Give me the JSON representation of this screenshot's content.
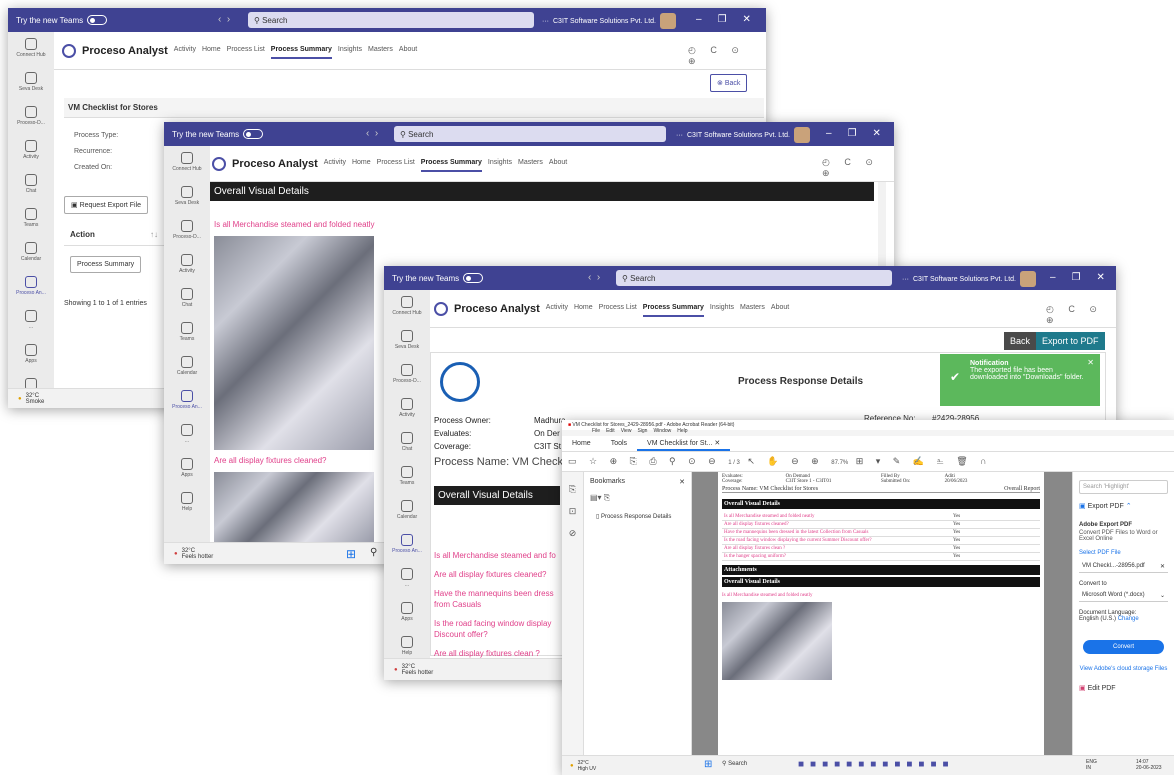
{
  "teams_common": {
    "try_label": "Try the new Teams",
    "search_placeholder": "Search",
    "org_name": "C3IT Software Solutions Pvt. Ltd.",
    "app_name": "Proceso Analyst",
    "nav": [
      "Activity",
      "Home",
      "Process List",
      "Process Summary",
      "Insights",
      "Masters",
      "About"
    ],
    "rail": [
      "Connect Hub",
      "Seva Desk",
      "Proceso-D...",
      "Activity",
      "Chat",
      "Teams",
      "Calendar",
      "Proceso An...",
      "...",
      "Apps",
      "Help"
    ]
  },
  "win1": {
    "back": "Back",
    "section_title": "VM Checklist for Stores",
    "fields": [
      "Process Type:",
      "Recurrence:",
      "Created On:"
    ],
    "request_export": "Request Export File",
    "col_action": "Action",
    "sort": "↑↓",
    "summary_button": "Process Summary",
    "entries": "Showing 1 to 1 of 1 entries",
    "weather_temp": "32°C",
    "weather_text": "Smoke"
  },
  "win2": {
    "header": "Overall Visual Details",
    "q1": "Is all Merchandise steamed and folded neatly",
    "q2": "Are all display fixtures cleaned?",
    "weather_temp": "32°C",
    "weather_text": "Feels hotter"
  },
  "win3": {
    "back": "Back",
    "export": "Export to PDF",
    "title": "Process Response Details",
    "owner_label": "Process Owner:",
    "owner_value": "Madhura",
    "evaluates_label": "Evaluates:",
    "evaluates_value": "On Der",
    "coverage_label": "Coverage:",
    "coverage_value": "C3IT St",
    "ref_label": "Reference No:",
    "ref_value": "#2429-28956",
    "process_name": "Process Name: VM Checkli",
    "section": "Overall Visual Details",
    "questions": [
      "Is all Merchandise steamed and fo",
      "Are all display fixtures cleaned?",
      "Have the mannequins been dress",
      "from Casuals",
      "Is the road facing window display",
      "Discount offer?",
      "Are all display fixtures clean ?"
    ],
    "notif_title": "Notification",
    "notif_text": "The exported file has been downloaded into \"Downloads\" folder.",
    "weather_temp": "32°C",
    "weather_text": "Feels hotter"
  },
  "pdf": {
    "title": "VM Checklist for Stores_2429-28956.pdf - Adobe Acrobat Reader (64-bit)",
    "menu": [
      "File",
      "Edit",
      "View",
      "Sign",
      "Window",
      "Help"
    ],
    "tabs": [
      "Home",
      "Tools",
      "VM Checklist for St..."
    ],
    "page": "1 / 3",
    "zoom": "87.7%",
    "bookmarks": "Bookmarks",
    "bookmark_item": "Process Response Details",
    "hdr_rows": [
      [
        "Evaluates:",
        "On Demand",
        "Filled By",
        "Aditi"
      ],
      [
        "Coverage:",
        "C3IT Store 1 - C3IT01",
        "Submitted On:",
        "20/06/2023"
      ]
    ],
    "process_name": "Process Name: VM Checklist for Stores",
    "overall_report": "Overall Report",
    "section": "Overall Visual Details",
    "rows": [
      [
        "Is all Merchandise steamed and folded neatly",
        "Yes"
      ],
      [
        "Are all display fixtures cleaned?",
        "Yes"
      ],
      [
        "Have the mannequins been dressed in the latest Collection from Casuals",
        "Yes"
      ],
      [
        "Is the road facing window displaying the current Summer Discount offer?",
        "Yes"
      ],
      [
        "Are all display fixtures clean ?",
        "Yes"
      ],
      [
        "Is the hanger spacing uniform?",
        "Yes"
      ]
    ],
    "attachments": "Attachments",
    "section2": "Overall Visual Details",
    "q_attach": "Is all Merchandise steamed and folded neatly",
    "search_highlight": "Search 'Highlight'",
    "export_pdf": "Export PDF",
    "adobe_export": "Adobe Export PDF",
    "convert_desc": "Convert PDF Files to Word or Excel Online",
    "select_pdf": "Select PDF File",
    "file_name": "VM Checkl...-28956.pdf",
    "convert_to": "Convert to",
    "format": "Microsoft Word (*.docx)",
    "doc_lang": "Document Language:",
    "lang": "English (U.S.)",
    "change": "Change",
    "convert_btn": "Convert",
    "cloud": "View Adobe's cloud storage Files",
    "edit_pdf": "Edit PDF",
    "weather_temp": "32°C",
    "weather_text": "High UV",
    "taskbar_search": "Search",
    "lang_eng": "ENG",
    "lang_in": "IN",
    "time": "14:07",
    "date": "20-06-2023"
  }
}
